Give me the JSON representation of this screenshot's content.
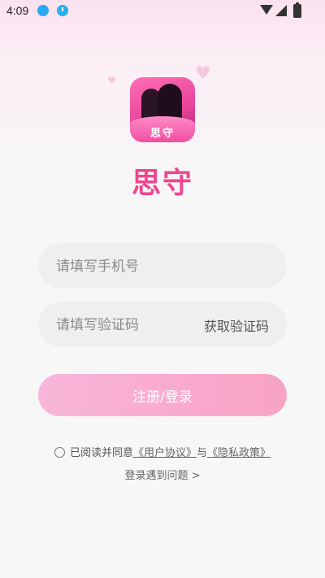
{
  "status_bar": {
    "time": "4:09"
  },
  "app": {
    "logo_text": "思守",
    "name": "思守"
  },
  "form": {
    "phone_placeholder": "请填写手机号",
    "code_placeholder": "请填写验证码",
    "get_code_label": "获取验证码",
    "submit_label": "注册/登录"
  },
  "agreement": {
    "prefix": "已阅读并同意",
    "user_agreement": "《用户协议》",
    "and": "与",
    "privacy_policy": "《隐私政策》"
  },
  "help_link": "登录遇到问题 >",
  "colors": {
    "accent": "#f0458f",
    "button": "#f9acd0"
  }
}
